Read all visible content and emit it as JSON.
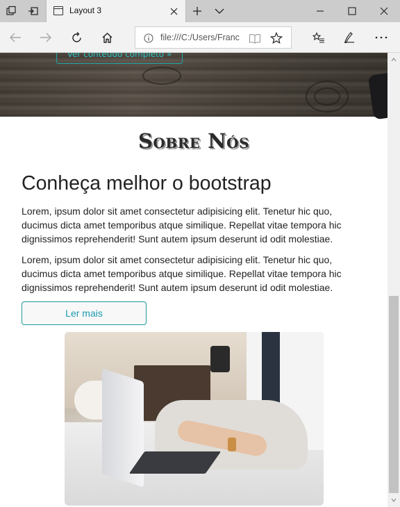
{
  "browser": {
    "tab_title": "Layout 3",
    "address": "file:///C:/Users/Franc",
    "icons": {
      "tab_actions": "tab-actions-icon",
      "set_aside": "set-aside-tabs-icon",
      "favicon": "page-icon",
      "close_tab": "close-icon",
      "new_tab": "plus-icon",
      "tab_list": "chevron-down-icon",
      "minimize": "minimize-icon",
      "maximize": "maximize-icon",
      "close_window": "close-icon",
      "back": "back-arrow-icon",
      "forward": "forward-arrow-icon",
      "refresh": "refresh-icon",
      "home": "home-icon",
      "info": "info-icon",
      "reading_view": "book-icon",
      "favorite": "star-icon",
      "favorites_hub": "favorites-list-icon",
      "notes": "pen-icon",
      "more": "more-icon"
    }
  },
  "page": {
    "hero_button": "Ver conteúdo completo »",
    "section_title": "Sobre Nós",
    "heading": "Conheça melhor o bootstrap",
    "paragraphs": [
      "Lorem, ipsum dolor sit amet consectetur adipisicing elit. Tenetur hic quo, ducimus dicta amet temporibus atque similique. Repellat vitae tempora hic dignissimos reprehenderit! Sunt autem ipsum deserunt id odit molestiae.",
      "Lorem, ipsum dolor sit amet consectetur adipisicing elit. Tenetur hic quo, ducimus dicta amet temporibus atque similique. Repellat vitae tempora hic dignissimos reprehenderit! Sunt autem ipsum deserunt id odit molestiae."
    ],
    "button_label": "Ler mais",
    "colors": {
      "accent": "#1c9ab0",
      "button_border": "#1c9a9a"
    }
  }
}
